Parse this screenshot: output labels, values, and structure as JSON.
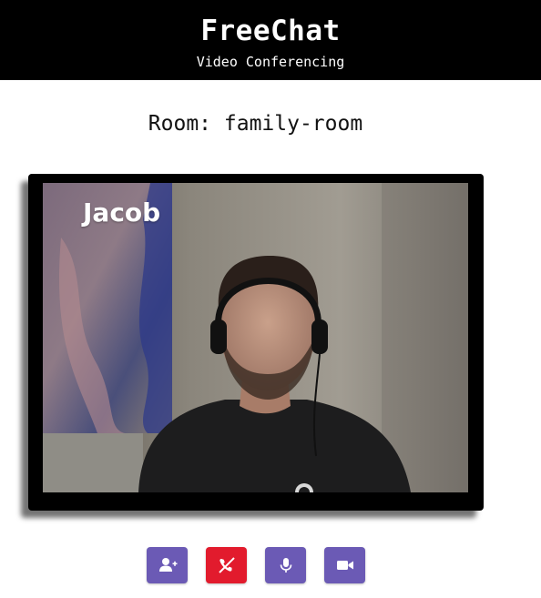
{
  "header": {
    "title": "FreeChat",
    "subtitle": "Video Conferencing"
  },
  "room": {
    "label": "Room: family-room"
  },
  "video": {
    "participant_name": "Jacob"
  },
  "controls": [
    {
      "name": "add-participant-button",
      "icon": "user-plus-icon",
      "color": "#6b5ab5"
    },
    {
      "name": "hang-up-button",
      "icon": "phone-hangup-icon",
      "color": "#e21b2d"
    },
    {
      "name": "microphone-button",
      "icon": "microphone-icon",
      "color": "#6b5ab5"
    },
    {
      "name": "camera-button",
      "icon": "video-camera-icon",
      "color": "#6b5ab5"
    }
  ],
  "colors": {
    "header_bg": "#000000",
    "accent": "#6b5ab5",
    "danger": "#e21b2d"
  }
}
